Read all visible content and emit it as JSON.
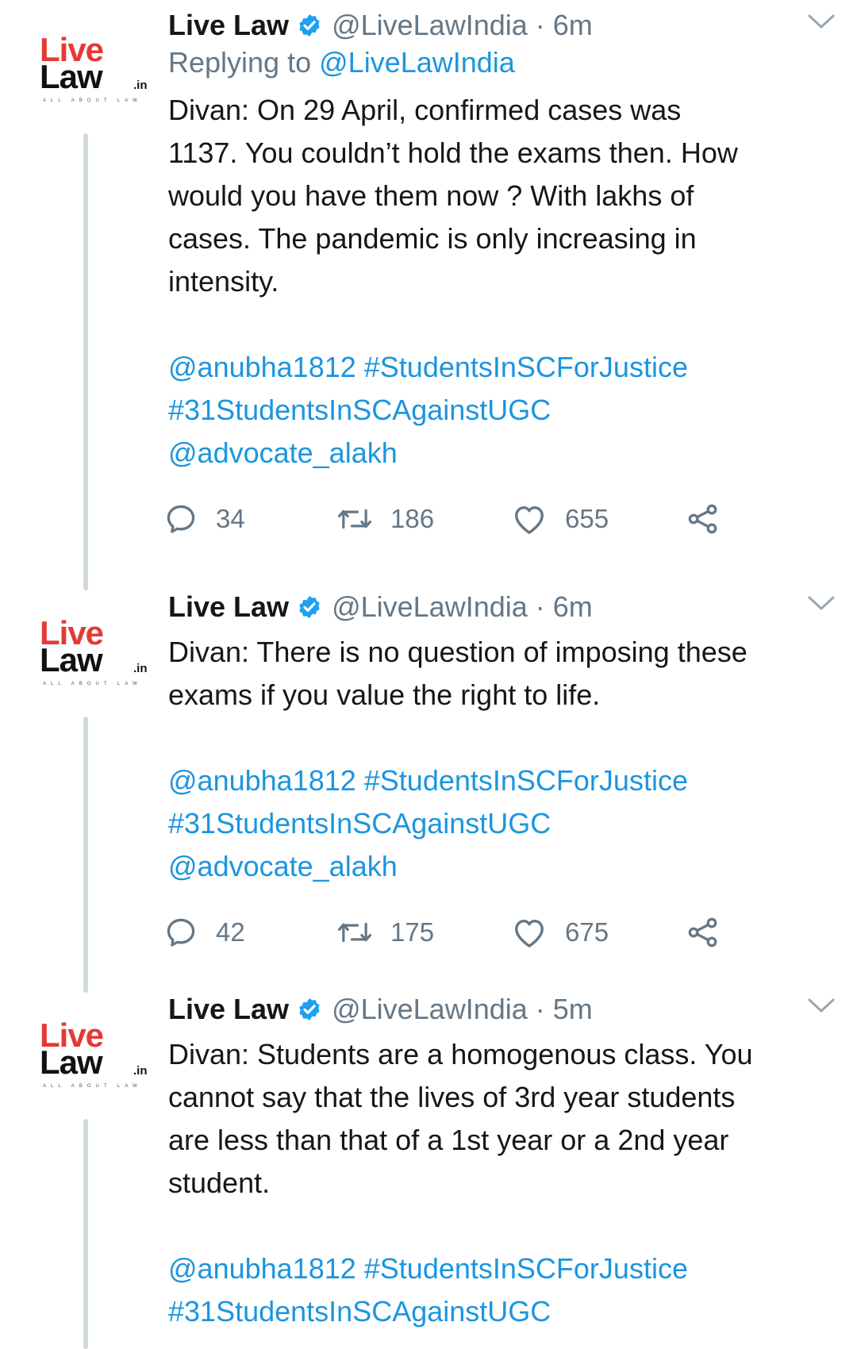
{
  "tweets": [
    {
      "author": "Live Law",
      "handle": "@LiveLawIndia · 6m",
      "reply_prefix": "Replying to",
      "reply_mention": "@LiveLawIndia",
      "text": "Divan: On 29 April, confirmed cases was\n1137. You couldn’t hold the exams then. How\nwould you have them now ? With lakhs of\ncases. The pandemic is only increasing in\nintensity.",
      "links_line1": "@anubha1812 #StudentsInSCForJustice",
      "links_line2": "#31StudentsInSCAgainstUGC",
      "links_line3": "@advocate_alakh",
      "replies": "34",
      "retweets": "186",
      "likes": "655"
    },
    {
      "author": "Live Law",
      "handle": "@LiveLawIndia · 6m",
      "text": "Divan: There is no question of imposing these\nexams if you value the right to life.",
      "links_line1": "@anubha1812 #StudentsInSCForJustice",
      "links_line2": "#31StudentsInSCAgainstUGC",
      "links_line3": "@advocate_alakh",
      "replies": "42",
      "retweets": "175",
      "likes": "675"
    },
    {
      "author": "Live Law",
      "handle": "@LiveLawIndia · 5m",
      "text": "Divan: Students are a homogenous class. You\ncannot say that the lives of 3rd year students\nare less than that of a 1st year or a 2nd year\nstudent.",
      "links_line1": "@anubha1812 #StudentsInSCForJustice",
      "links_line2": "#31StudentsInSCAgainstUGC"
    }
  ],
  "logo": {
    "live": "Live",
    "law": "Law",
    "tld": ".in",
    "tagline": "ALL ABOUT LAW"
  },
  "colors": {
    "link": "#1b95e0",
    "muted": "#657786",
    "logo_red": "#e53935",
    "thread_line": "#cfd9de"
  }
}
